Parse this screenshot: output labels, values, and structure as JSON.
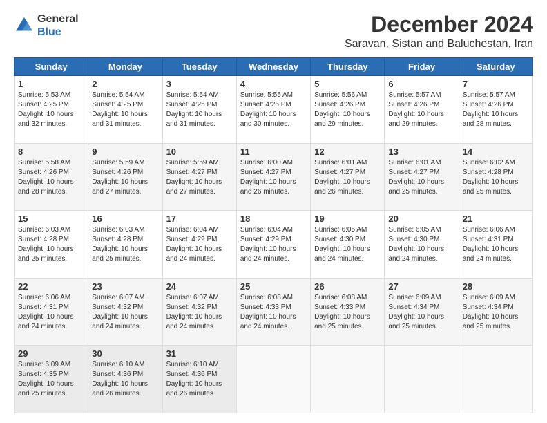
{
  "logo": {
    "general": "General",
    "blue": "Blue"
  },
  "header": {
    "month": "December 2024",
    "location": "Saravan, Sistan and Baluchestan, Iran"
  },
  "weekdays": [
    "Sunday",
    "Monday",
    "Tuesday",
    "Wednesday",
    "Thursday",
    "Friday",
    "Saturday"
  ],
  "weeks": [
    [
      {
        "day": "1",
        "sunrise": "5:53 AM",
        "sunset": "4:25 PM",
        "daylight": "10 hours and 32 minutes."
      },
      {
        "day": "2",
        "sunrise": "5:54 AM",
        "sunset": "4:25 PM",
        "daylight": "10 hours and 31 minutes."
      },
      {
        "day": "3",
        "sunrise": "5:54 AM",
        "sunset": "4:25 PM",
        "daylight": "10 hours and 31 minutes."
      },
      {
        "day": "4",
        "sunrise": "5:55 AM",
        "sunset": "4:26 PM",
        "daylight": "10 hours and 30 minutes."
      },
      {
        "day": "5",
        "sunrise": "5:56 AM",
        "sunset": "4:26 PM",
        "daylight": "10 hours and 29 minutes."
      },
      {
        "day": "6",
        "sunrise": "5:57 AM",
        "sunset": "4:26 PM",
        "daylight": "10 hours and 29 minutes."
      },
      {
        "day": "7",
        "sunrise": "5:57 AM",
        "sunset": "4:26 PM",
        "daylight": "10 hours and 28 minutes."
      }
    ],
    [
      {
        "day": "8",
        "sunrise": "5:58 AM",
        "sunset": "4:26 PM",
        "daylight": "10 hours and 28 minutes."
      },
      {
        "day": "9",
        "sunrise": "5:59 AM",
        "sunset": "4:26 PM",
        "daylight": "10 hours and 27 minutes."
      },
      {
        "day": "10",
        "sunrise": "5:59 AM",
        "sunset": "4:27 PM",
        "daylight": "10 hours and 27 minutes."
      },
      {
        "day": "11",
        "sunrise": "6:00 AM",
        "sunset": "4:27 PM",
        "daylight": "10 hours and 26 minutes."
      },
      {
        "day": "12",
        "sunrise": "6:01 AM",
        "sunset": "4:27 PM",
        "daylight": "10 hours and 26 minutes."
      },
      {
        "day": "13",
        "sunrise": "6:01 AM",
        "sunset": "4:27 PM",
        "daylight": "10 hours and 25 minutes."
      },
      {
        "day": "14",
        "sunrise": "6:02 AM",
        "sunset": "4:28 PM",
        "daylight": "10 hours and 25 minutes."
      }
    ],
    [
      {
        "day": "15",
        "sunrise": "6:03 AM",
        "sunset": "4:28 PM",
        "daylight": "10 hours and 25 minutes."
      },
      {
        "day": "16",
        "sunrise": "6:03 AM",
        "sunset": "4:28 PM",
        "daylight": "10 hours and 25 minutes."
      },
      {
        "day": "17",
        "sunrise": "6:04 AM",
        "sunset": "4:29 PM",
        "daylight": "10 hours and 24 minutes."
      },
      {
        "day": "18",
        "sunrise": "6:04 AM",
        "sunset": "4:29 PM",
        "daylight": "10 hours and 24 minutes."
      },
      {
        "day": "19",
        "sunrise": "6:05 AM",
        "sunset": "4:30 PM",
        "daylight": "10 hours and 24 minutes."
      },
      {
        "day": "20",
        "sunrise": "6:05 AM",
        "sunset": "4:30 PM",
        "daylight": "10 hours and 24 minutes."
      },
      {
        "day": "21",
        "sunrise": "6:06 AM",
        "sunset": "4:31 PM",
        "daylight": "10 hours and 24 minutes."
      }
    ],
    [
      {
        "day": "22",
        "sunrise": "6:06 AM",
        "sunset": "4:31 PM",
        "daylight": "10 hours and 24 minutes."
      },
      {
        "day": "23",
        "sunrise": "6:07 AM",
        "sunset": "4:32 PM",
        "daylight": "10 hours and 24 minutes."
      },
      {
        "day": "24",
        "sunrise": "6:07 AM",
        "sunset": "4:32 PM",
        "daylight": "10 hours and 24 minutes."
      },
      {
        "day": "25",
        "sunrise": "6:08 AM",
        "sunset": "4:33 PM",
        "daylight": "10 hours and 24 minutes."
      },
      {
        "day": "26",
        "sunrise": "6:08 AM",
        "sunset": "4:33 PM",
        "daylight": "10 hours and 25 minutes."
      },
      {
        "day": "27",
        "sunrise": "6:09 AM",
        "sunset": "4:34 PM",
        "daylight": "10 hours and 25 minutes."
      },
      {
        "day": "28",
        "sunrise": "6:09 AM",
        "sunset": "4:34 PM",
        "daylight": "10 hours and 25 minutes."
      }
    ],
    [
      {
        "day": "29",
        "sunrise": "6:09 AM",
        "sunset": "4:35 PM",
        "daylight": "10 hours and 25 minutes."
      },
      {
        "day": "30",
        "sunrise": "6:10 AM",
        "sunset": "4:36 PM",
        "daylight": "10 hours and 26 minutes."
      },
      {
        "day": "31",
        "sunrise": "6:10 AM",
        "sunset": "4:36 PM",
        "daylight": "10 hours and 26 minutes."
      },
      null,
      null,
      null,
      null
    ]
  ]
}
